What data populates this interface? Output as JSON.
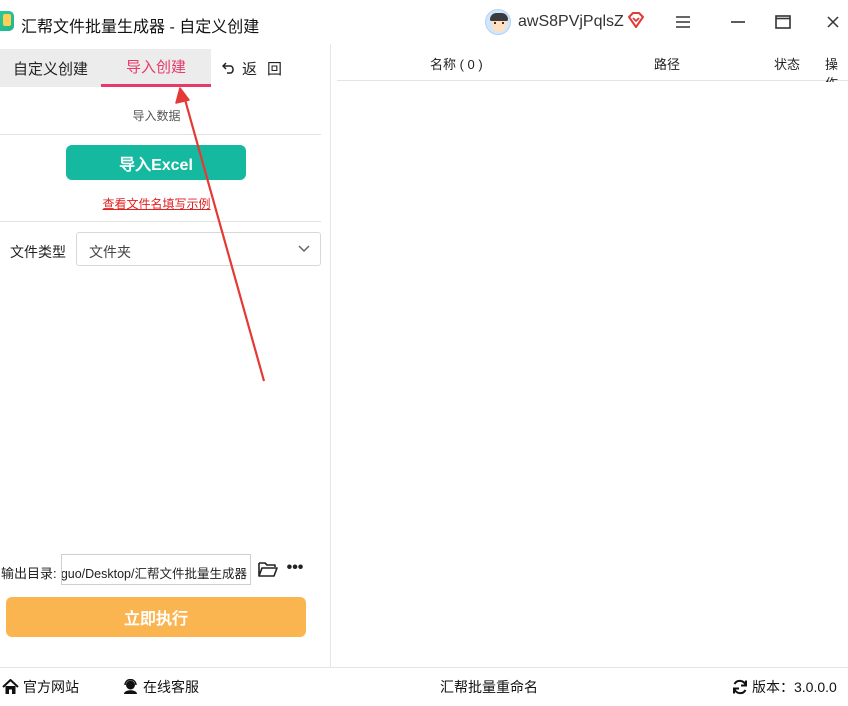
{
  "window": {
    "title": "汇帮文件批量生成器 - 自定义创建",
    "username": "awS8PVjPqlsZ"
  },
  "tabs": {
    "custom": "自定义创建",
    "import": "导入创建",
    "back": "返回"
  },
  "import_section": {
    "label": "导入数据",
    "button": "导入Excel",
    "example_link": "查看文件名填写示例"
  },
  "file_type": {
    "label": "文件类型",
    "value": "文件夹"
  },
  "output": {
    "label": "输出目录:",
    "path": "guo/Desktop/汇帮文件批量生成器"
  },
  "run_button": "立即执行",
  "table": {
    "columns": {
      "name": "名称 ( 0 )",
      "path": "路径",
      "status": "状态",
      "action": "操作"
    },
    "rows": []
  },
  "footer": {
    "website": "官方网站",
    "service": "在线客服",
    "rename": "汇帮批量重命名",
    "version": "版本：3.0.0.0"
  },
  "colors": {
    "accent_tab": "#e8396a",
    "import_button": "#14b9a0",
    "run_button": "#fbb550",
    "link": "#e02020",
    "annotation_arrow": "#e53935"
  }
}
